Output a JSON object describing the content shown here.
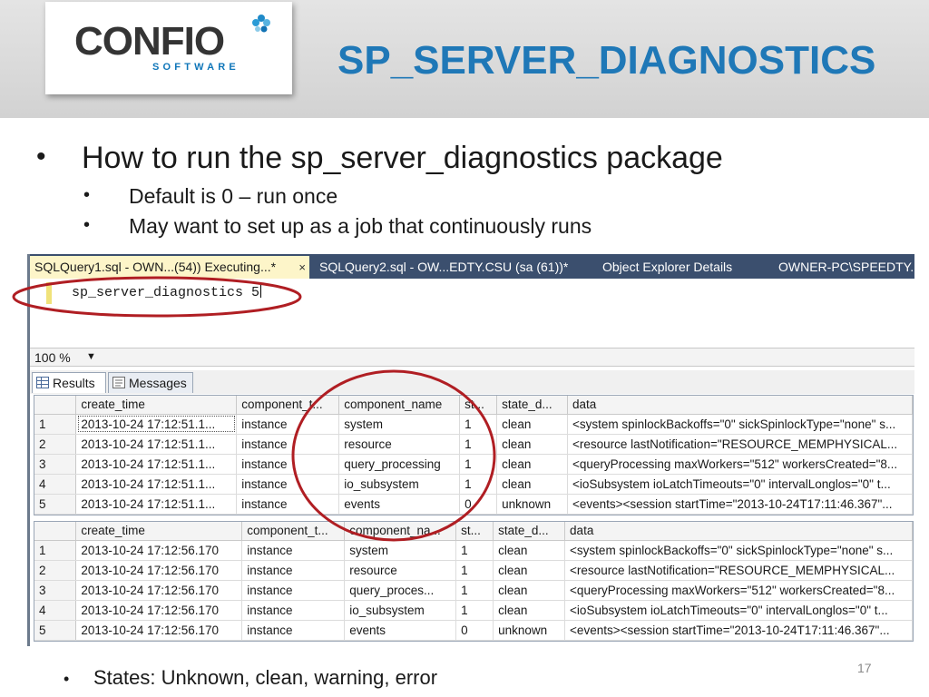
{
  "header": {
    "logo_text": "CONFIO",
    "logo_subtext": "SOFTWARE",
    "title": "SP_SERVER_DIAGNOSTICS"
  },
  "bullets": {
    "main": "How to run the sp_server_diagnostics package",
    "sub": [
      "Default is 0 – run once",
      "May want to set up as a job that continuously runs"
    ],
    "bottom": "States: Unknown, clean, warning, error"
  },
  "ssms": {
    "tabs": [
      {
        "label": "SQLQuery1.sql - OWN...(54)) Executing...*",
        "close": "×"
      },
      {
        "label": "SQLQuery2.sql - OW...EDTY.CSU (sa (61))*"
      },
      {
        "label": "Object Explorer Details"
      },
      {
        "label": "OWNER-PC\\SPEEDTY..."
      }
    ],
    "query_text": "sp_server_diagnostics 5",
    "zoom": "100 %",
    "zoom_arrow": "▼",
    "result_tabs": [
      "Results",
      "Messages"
    ],
    "grid1": {
      "headers": [
        "create_time",
        "component_t...",
        "component_name",
        "st...",
        "state_d...",
        "data"
      ],
      "rows": [
        [
          "1",
          "2013-10-24 17:12:51.1...",
          "instance",
          "system",
          "1",
          "clean",
          "<system spinlockBackoffs=\"0\" sickSpinlockType=\"none\" s..."
        ],
        [
          "2",
          "2013-10-24 17:12:51.1...",
          "instance",
          "resource",
          "1",
          "clean",
          "<resource lastNotification=\"RESOURCE_MEMPHYSICAL..."
        ],
        [
          "3",
          "2013-10-24 17:12:51.1...",
          "instance",
          "query_processing",
          "1",
          "clean",
          "<queryProcessing maxWorkers=\"512\" workersCreated=\"8..."
        ],
        [
          "4",
          "2013-10-24 17:12:51.1...",
          "instance",
          "io_subsystem",
          "1",
          "clean",
          "<ioSubsystem ioLatchTimeouts=\"0\" intervalLonglos=\"0\" t..."
        ],
        [
          "5",
          "2013-10-24 17:12:51.1...",
          "instance",
          "events",
          "0",
          "unknown",
          "<events><session startTime=\"2013-10-24T17:11:46.367\"..."
        ]
      ]
    },
    "grid2": {
      "headers": [
        "create_time",
        "component_t...",
        "component_na...",
        "st...",
        "state_d...",
        "data"
      ],
      "rows": [
        [
          "1",
          "2013-10-24 17:12:56.170",
          "instance",
          "system",
          "1",
          "clean",
          "<system spinlockBackoffs=\"0\" sickSpinlockType=\"none\" s..."
        ],
        [
          "2",
          "2013-10-24 17:12:56.170",
          "instance",
          "resource",
          "1",
          "clean",
          "<resource lastNotification=\"RESOURCE_MEMPHYSICAL..."
        ],
        [
          "3",
          "2013-10-24 17:12:56.170",
          "instance",
          "query_proces...",
          "1",
          "clean",
          "<queryProcessing maxWorkers=\"512\" workersCreated=\"8..."
        ],
        [
          "4",
          "2013-10-24 17:12:56.170",
          "instance",
          "io_subsystem",
          "1",
          "clean",
          "<ioSubsystem ioLatchTimeouts=\"0\" intervalLonglos=\"0\" t..."
        ],
        [
          "5",
          "2013-10-24 17:12:56.170",
          "instance",
          "events",
          "0",
          "unknown",
          "<events><session startTime=\"2013-10-24T17:11:46.367\"..."
        ]
      ]
    }
  },
  "page_number": "17",
  "colors": {
    "title_blue": "#1f78b7",
    "annotation_red": "#b01e23",
    "tabbar": "#3b4f6e",
    "active_tab": "#fdf5c9"
  }
}
